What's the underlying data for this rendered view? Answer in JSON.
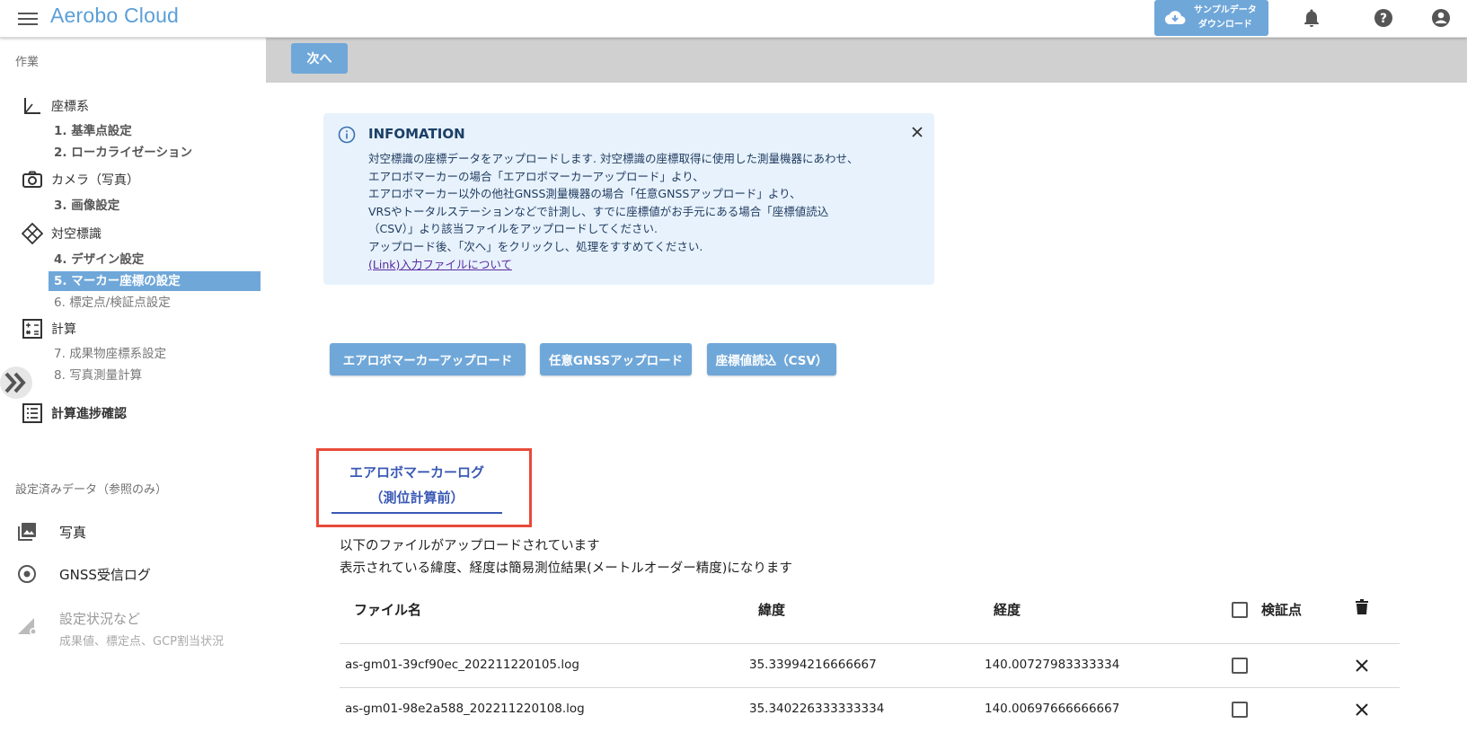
{
  "header": {
    "brand": "Aerobo Cloud",
    "download_line1": "サンプルデータ",
    "download_line2": "ダウンロード"
  },
  "sidebar": {
    "work_label": "作業",
    "categories": [
      {
        "label": "座標系",
        "icon": "axis-icon"
      },
      {
        "label": "カメラ（写真）",
        "icon": "camera-icon"
      },
      {
        "label": "対空標識",
        "icon": "marker-diamond-icon"
      },
      {
        "label": "計算",
        "icon": "calculator-icon"
      },
      {
        "label": "計算進捗確認",
        "icon": "list-icon"
      }
    ],
    "steps": [
      {
        "num": "1.",
        "label": "基準点設定",
        "state": "done"
      },
      {
        "num": "2.",
        "label": "ローカライゼーション",
        "state": "done"
      },
      {
        "num": "3.",
        "label": "画像設定",
        "state": "done"
      },
      {
        "num": "4.",
        "label": "デザイン設定",
        "state": "done"
      },
      {
        "num": "5.",
        "label": "マーカー座標の設定",
        "state": "active"
      },
      {
        "num": "6.",
        "label": "標定点/検証点設定",
        "state": "pending"
      },
      {
        "num": "7.",
        "label": "成果物座標系設定",
        "state": "pending"
      },
      {
        "num": "8.",
        "label": "写真測量計算",
        "state": "pending"
      }
    ],
    "ref_label": "設定済みデータ（参照のみ）",
    "ref_items": [
      {
        "label": "写真",
        "icon": "photo-icon"
      },
      {
        "label": "GNSS受信ログ",
        "icon": "gnss-icon"
      },
      {
        "label": "設定状況など",
        "sub": "成果値、標定点、GCP割当状況",
        "icon": "settings-status-icon"
      }
    ]
  },
  "toolbar": {
    "next_label": "次へ"
  },
  "info": {
    "title": "INFOMATION",
    "lines": [
      "対空標識の座標データをアップロードします. 対空標識の座標取得に使用した測量機器にあわせ、",
      "エアロボマーカーの場合「エアロボマーカーアップロード」より、",
      "エアロボマーカー以外の他社GNSS測量機器の場合「任意GNSSアップロード」より、",
      "VRSやトータルステーションなどで計測し、すでに座標値がお手元にある場合「座標値読込",
      "（CSV）」より該当ファイルをアップロードしてください.",
      "アップロード後、「次へ」をクリックし、処理をすすめてください."
    ],
    "link": "(Link)入力ファイルについて"
  },
  "upload_buttons": {
    "marker": "エアロボマーカーアップロード",
    "gnss": "任意GNSSアップロード",
    "csv": "座標値読込（CSV）"
  },
  "log_tab": {
    "line1": "エアロボマーカーログ",
    "line2": "（測位計算前）"
  },
  "desc": {
    "line1": "以下のファイルがアップロードされています",
    "line2": "表示されている緯度、経度は簡易測位結果(メートルオーダー精度)になります"
  },
  "table": {
    "headers": {
      "filename": "ファイル名",
      "lat": "緯度",
      "lon": "経度",
      "verify": "検証点"
    },
    "rows": [
      {
        "filename": "as-gm01-39cf90ec_202211220105.log",
        "lat": "35.33994216666667",
        "lon": "140.00727983333334"
      },
      {
        "filename": "as-gm01-98e2a588_202211220108.log",
        "lat": "35.340226333333334",
        "lon": "140.00697666666667"
      }
    ]
  },
  "colors": {
    "accent": "#6fa7d9",
    "brand": "#5b9fd8",
    "info_bg": "#e7f2fc",
    "highlight": "#e84a3a",
    "tab": "#3a59b5"
  }
}
